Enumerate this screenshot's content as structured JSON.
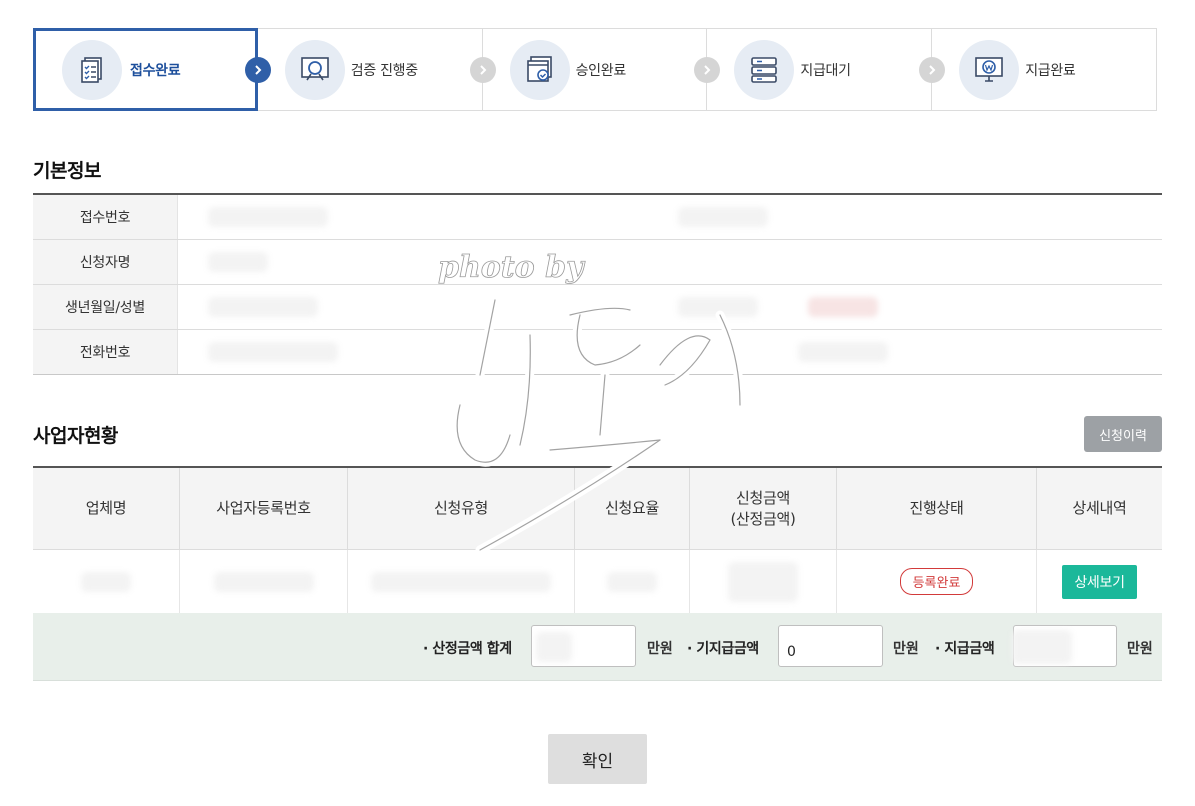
{
  "steps": [
    {
      "label": "접수완료",
      "icon": "document-list-icon",
      "active": true
    },
    {
      "label": "검증 진행중",
      "icon": "magnifier-icon",
      "active": false
    },
    {
      "label": "승인완료",
      "icon": "approved-window-icon",
      "active": false
    },
    {
      "label": "지급대기",
      "icon": "server-stack-icon",
      "active": false
    },
    {
      "label": "지급완료",
      "icon": "monitor-won-icon",
      "active": false
    }
  ],
  "basic_info": {
    "title": "기본정보",
    "rows": [
      {
        "label": "접수번호"
      },
      {
        "label": "신청자명"
      },
      {
        "label": "생년월일/성별"
      },
      {
        "label": "전화번호"
      }
    ]
  },
  "business": {
    "title": "사업자현황",
    "history_button": "신청이력",
    "headers": [
      "업체명",
      "사업자등록번호",
      "신청유형",
      "신청요율",
      "신청금액\n(산정금액)",
      "진행상태",
      "상세내역"
    ],
    "status_badge": "등록완료",
    "detail_button": "상세보기"
  },
  "summary": {
    "calc_total_label": "· 산정금액 합계",
    "calc_total_unit": "만원",
    "prepaid_label": "· 기지급금액",
    "prepaid_value": "0",
    "prepaid_unit": "만원",
    "pay_label": "· 지급금액",
    "pay_unit": "만원"
  },
  "confirm_button": "확인",
  "watermark": {
    "text": "photo by",
    "signature": "히도리"
  },
  "colors": {
    "accent": "#2f5fa8",
    "status_red": "#d23a3a",
    "detail_green": "#1bb89a"
  }
}
